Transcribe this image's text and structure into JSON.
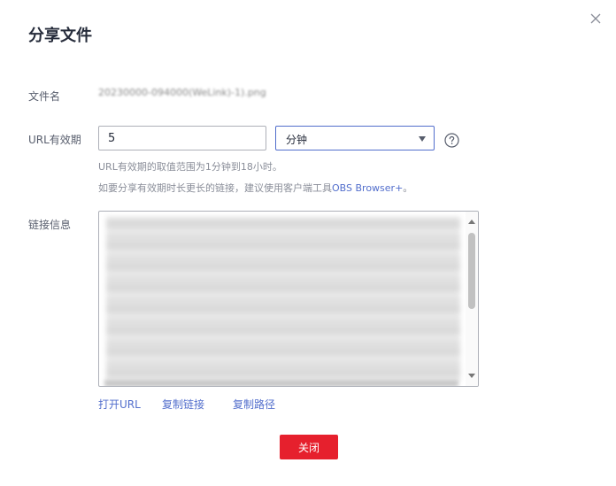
{
  "dialog": {
    "title": "分享文件",
    "close_icon": "close-icon"
  },
  "file": {
    "label": "文件名",
    "value": "20230000-094000(WeLink)-1).png"
  },
  "url_validity": {
    "label": "URL有效期",
    "value": "5",
    "unit_selected": "分钟",
    "help_icon": "question-circle-icon",
    "hint1": "URL有效期的取值范围为1分钟到18小时。",
    "hint2_prefix": "如要分享有效期时长更长的链接，建议使用客户端工具",
    "hint2_link": "OBS Browser+",
    "hint2_suffix": "。"
  },
  "link_info": {
    "label": "链接信息"
  },
  "actions": {
    "open_url": "打开URL",
    "copy_link": "复制链接",
    "copy_path": "复制路径"
  },
  "footer": {
    "close_label": "关闭"
  },
  "colors": {
    "primary_red": "#e6202d",
    "link_blue": "#526ecc",
    "select_border": "#526ecc"
  }
}
